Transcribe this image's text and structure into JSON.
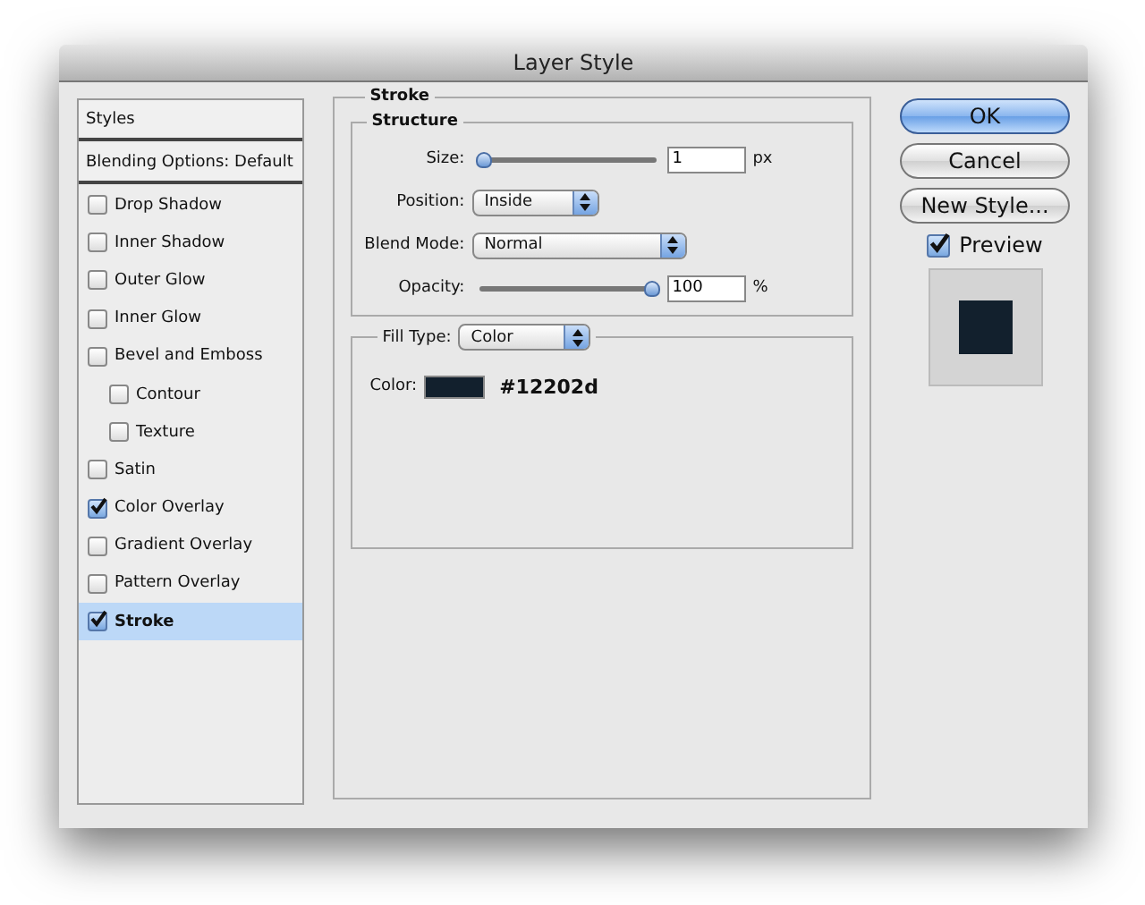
{
  "window": {
    "title": "Layer Style"
  },
  "styles_panel": {
    "header": "Styles",
    "blending_options": "Blending Options: Default",
    "items": [
      {
        "label": "Drop Shadow",
        "checked": false,
        "selected": false
      },
      {
        "label": "Inner Shadow",
        "checked": false,
        "selected": false
      },
      {
        "label": "Outer Glow",
        "checked": false,
        "selected": false
      },
      {
        "label": "Inner Glow",
        "checked": false,
        "selected": false
      },
      {
        "label": "Bevel and Emboss",
        "checked": false,
        "selected": false,
        "children": [
          {
            "label": "Contour",
            "checked": false,
            "selected": false
          },
          {
            "label": "Texture",
            "checked": false,
            "selected": false
          }
        ]
      },
      {
        "label": "Satin",
        "checked": false,
        "selected": false
      },
      {
        "label": "Color Overlay",
        "checked": true,
        "selected": false
      },
      {
        "label": "Gradient Overlay",
        "checked": false,
        "selected": false
      },
      {
        "label": "Pattern Overlay",
        "checked": false,
        "selected": false
      },
      {
        "label": "Stroke",
        "checked": true,
        "selected": true
      }
    ]
  },
  "stroke": {
    "title": "Stroke",
    "structure": {
      "title": "Structure",
      "size": {
        "label": "Size:",
        "level": 0,
        "value": "1",
        "unit": "px"
      },
      "position": {
        "label": "Position:",
        "value": "Inside"
      },
      "blend_mode": {
        "label": "Blend Mode:",
        "value": "Normal"
      },
      "opacity": {
        "label": "Opacity:",
        "level": 1,
        "value": "100",
        "unit": "%"
      }
    },
    "fill": {
      "label": "Fill Type:",
      "value": "Color",
      "color_label": "Color:",
      "color": "#12202d",
      "hex": "#12202d"
    }
  },
  "actions": {
    "buttons": [
      {
        "label": "OK",
        "default": true
      },
      {
        "label": "Cancel",
        "default": false
      },
      {
        "label": "New Style...",
        "default": false
      }
    ],
    "preview": {
      "label": "Preview",
      "checked": true
    }
  }
}
